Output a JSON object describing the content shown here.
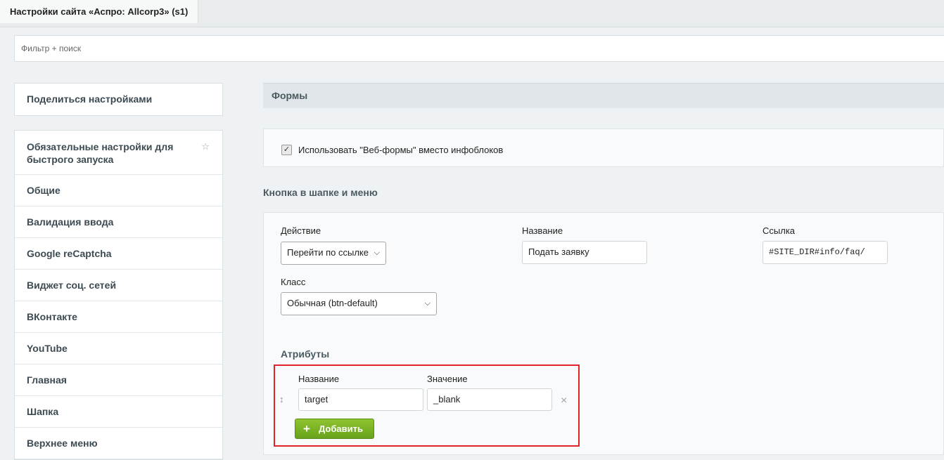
{
  "window": {
    "tab_title": "Настройки сайта «Аспро: Allcorp3» (s1)"
  },
  "filter": {
    "placeholder": "Фильтр + поиск"
  },
  "share_button": "Поделиться настройками",
  "sidebar": {
    "items": [
      {
        "label": "Обязательные настройки для быстрого запуска",
        "starred": true
      },
      {
        "label": "Общие"
      },
      {
        "label": "Валидация ввода"
      },
      {
        "label": "Google reCaptcha"
      },
      {
        "label": "Виджет соц. сетей"
      },
      {
        "label": "ВКонтакте"
      },
      {
        "label": "YouTube"
      },
      {
        "label": "Главная"
      },
      {
        "label": "Шапка"
      },
      {
        "label": "Верхнее меню"
      }
    ],
    "star_glyph": "☆"
  },
  "main": {
    "section_title": "Формы",
    "webforms_checkbox": {
      "label": "Использовать \"Веб-формы\" вместо инфоблоков",
      "checked": true
    },
    "button_section_title": "Кнопка в шапке и меню",
    "action": {
      "label": "Действие",
      "value": "Перейти по ссылке"
    },
    "name": {
      "label": "Название",
      "value": "Подать заявку"
    },
    "link": {
      "label": "Ссылка",
      "value": "#SITE_DIR#info/faq/"
    },
    "class": {
      "label": "Класс",
      "value": "Обычная (btn-default)"
    },
    "attributes": {
      "title": "Атрибуты",
      "name_header": "Название",
      "value_header": "Значение",
      "rows": [
        {
          "name": "target",
          "value": "_blank"
        }
      ],
      "add_label": "Добавить",
      "highlight_color": "#e2242a"
    }
  },
  "icons": {
    "checkbox": "checkmark-icon",
    "dropdown": "chevron-down-icon",
    "drag": "drag-handle-icon",
    "remove": "close-icon",
    "add": "plus-icon",
    "star": "star-icon"
  },
  "colors": {
    "accent_green": "#6aa31d",
    "page_bg": "#eef2f4"
  }
}
